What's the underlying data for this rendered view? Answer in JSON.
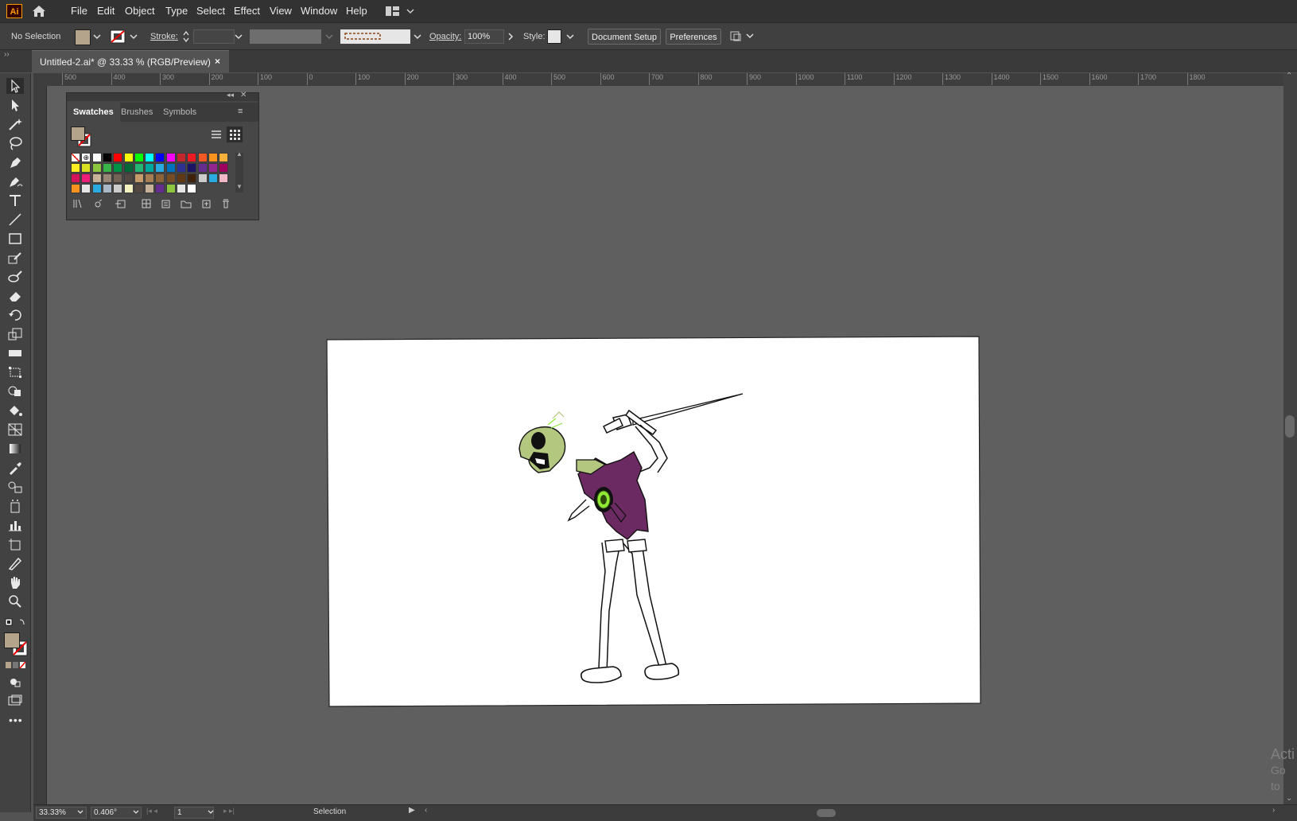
{
  "app": {
    "logo": "Ai"
  },
  "menu": [
    "File",
    "Edit",
    "Object",
    "Type",
    "Select",
    "Effect",
    "View",
    "Window",
    "Help"
  ],
  "control": {
    "selection": "No Selection",
    "stroke_label": "Stroke:",
    "opacity_label": "Opacity:",
    "opacity_value": "100%",
    "style_label": "Style:",
    "doc_setup": "Document Setup",
    "preferences": "Preferences"
  },
  "tab": {
    "title": "Untitled-2.ai* @ 33.33 % (RGB/Preview)",
    "close": "×"
  },
  "ruler": {
    "h_labels": [
      "500",
      "400",
      "300",
      "200",
      "100",
      "0",
      "100",
      "200",
      "300",
      "400",
      "500",
      "600",
      "700",
      "800",
      "900",
      "1000",
      "1100",
      "1200",
      "1300",
      "1400",
      "1500",
      "1600",
      "1700",
      "1800"
    ]
  },
  "swatches_panel": {
    "tabs": [
      "Swatches",
      "Brushes",
      "Symbols"
    ],
    "active_tab": "Swatches",
    "rows": [
      [
        "none",
        "register",
        "#ffffff",
        "#000000",
        "#ff0000",
        "#ffff00",
        "#00ff00",
        "#00ffff",
        "#0000ff",
        "#ff00ff",
        "#c1272d",
        "#ed1c24",
        "#f15a24",
        "#f7931e",
        "#fbb03b"
      ],
      [
        "#fcee21",
        "#d9e021",
        "#8cc63f",
        "#39b54a",
        "#009245",
        "#006837",
        "#22b573",
        "#00a99d",
        "#29abe2",
        "#0071bc",
        "#2e3192",
        "#1b1464",
        "#662d91",
        "#93278f",
        "#9e005d"
      ],
      [
        "#d4145a",
        "#ed1e79",
        "#c7b299",
        "#998675",
        "#736357",
        "#534741",
        "#c69c6d",
        "#a67c52",
        "#8c6239",
        "#754c24",
        "#603813",
        "#42210b",
        "#cccccc",
        "#29abe2",
        "#f2b8c6"
      ],
      [
        "#f7931e",
        "#e6e6e6",
        "#29abe2",
        "#aab7c4",
        "#cccccc",
        "#f2f2c0",
        "#534741",
        "#c7b299",
        "#662d91",
        "#8cc63f",
        "#e6e6e6",
        "#ffffff"
      ]
    ]
  },
  "status": {
    "zoom": "33.33%",
    "angle": "0.406°",
    "artboard": "1",
    "tool": "Selection"
  },
  "watermark": [
    "Acti",
    "Go to"
  ],
  "colors": {
    "fill": "#b5a48c",
    "skin": "#b3c77f",
    "shirt": "#6b2a62",
    "eye": "#8fe836",
    "accent": "#ff9a00"
  }
}
